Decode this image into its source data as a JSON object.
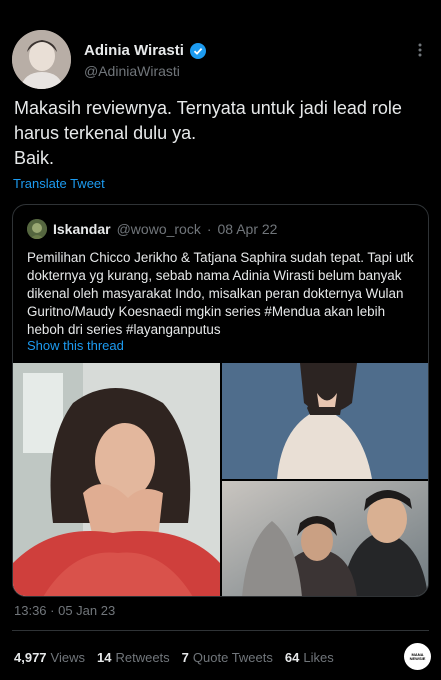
{
  "author": {
    "name": "Adinia Wirasti",
    "handle": "@AdiniaWirasti"
  },
  "tweet": {
    "text": "Makasih reviewnya. Ternyata untuk jadi lead role harus terkenal dulu ya.\nBaik.",
    "translate_label": "Translate Tweet"
  },
  "quote": {
    "author_name": "Iskandar",
    "author_handle": "@wowo_rock",
    "separator": "·",
    "date": "08 Apr 22",
    "text": "Pemilihan Chicco Jerikho & Tatjana Saphira sudah tepat. Tapi utk dokternya yg kurang, sebab nama Adinia Wirasti belum banyak dikenal oleh masyarakat Indo, misalkan peran dokternya Wulan Guritno/Maudy Koesnaedi mgkin series #Mendua akan lebih heboh dri series #layanganputus",
    "show_thread": "Show this thread"
  },
  "timestamp": "13:36 · 05 Jan 23",
  "stats": [
    {
      "num": "4,977",
      "label": "Views"
    },
    {
      "num": "14",
      "label": "Retweets"
    },
    {
      "num": "7",
      "label": "Quote Tweets"
    },
    {
      "num": "64",
      "label": "Likes"
    }
  ],
  "watermark": "MANA NEWSIE",
  "colors": {
    "accent": "#1d9bf0",
    "background": "#000000",
    "muted": "#71767b",
    "border": "#2f3336"
  },
  "icons": {
    "verified": "verified-badge-icon",
    "more": "more-dots-icon"
  }
}
